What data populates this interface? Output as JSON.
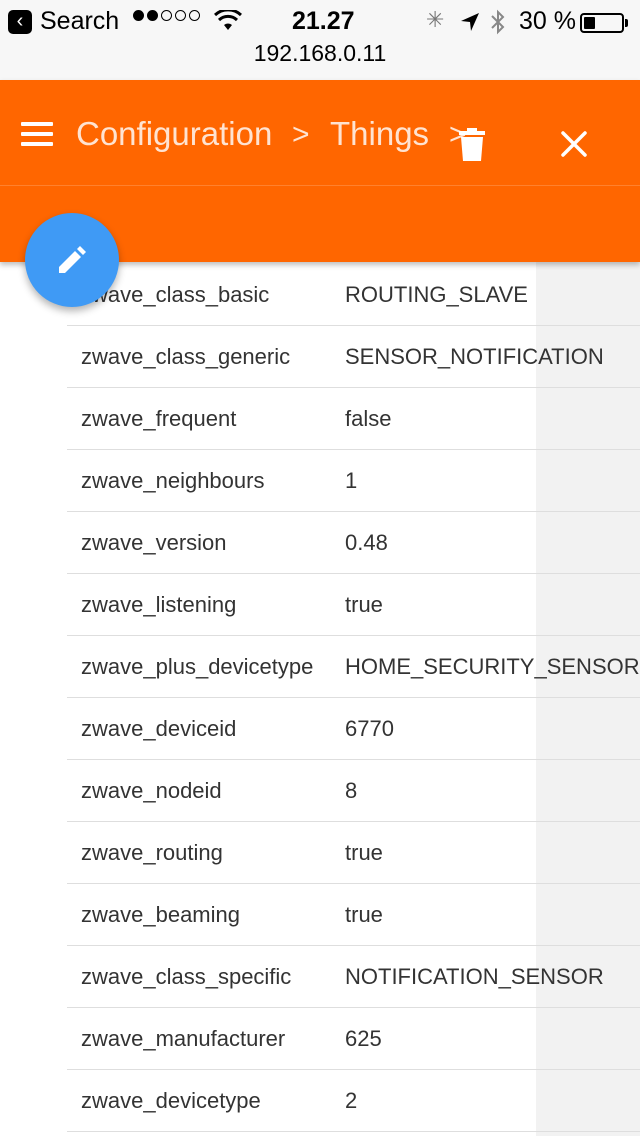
{
  "status_bar": {
    "back_app": "Search",
    "time": "21.27",
    "battery": "30 %",
    "battery_level": 0.3,
    "url": "192.168.0.11"
  },
  "header": {
    "breadcrumb": [
      "Configuration",
      "Things"
    ],
    "separator": ">"
  },
  "properties": [
    {
      "key": "zwave_class_basic",
      "value": "ROUTING_SLAVE"
    },
    {
      "key": "zwave_class_generic",
      "value": "SENSOR_NOTIFICATION"
    },
    {
      "key": "zwave_frequent",
      "value": "false"
    },
    {
      "key": "zwave_neighbours",
      "value": "1"
    },
    {
      "key": "zwave_version",
      "value": "0.48"
    },
    {
      "key": "zwave_listening",
      "value": "true"
    },
    {
      "key": "zwave_plus_devicetype",
      "value": "HOME_SECURITY_SENSOR"
    },
    {
      "key": "zwave_deviceid",
      "value": "6770"
    },
    {
      "key": "zwave_nodeid",
      "value": "8"
    },
    {
      "key": "zwave_routing",
      "value": "true"
    },
    {
      "key": "zwave_beaming",
      "value": "true"
    },
    {
      "key": "zwave_class_specific",
      "value": "NOTIFICATION_SENSOR"
    },
    {
      "key": "zwave_manufacturer",
      "value": "625"
    },
    {
      "key": "zwave_devicetype",
      "value": "2"
    }
  ],
  "colors": {
    "header": "#ff6600",
    "fab": "#3f9af5"
  },
  "icons": [
    "back-icon",
    "signal-dots-icon",
    "wifi-icon",
    "activity-spinner-icon",
    "location-arrow-icon",
    "bluetooth-icon",
    "battery-icon",
    "menu-icon",
    "chevron-right-icon",
    "trash-icon",
    "close-icon",
    "edit-pencil-icon"
  ]
}
